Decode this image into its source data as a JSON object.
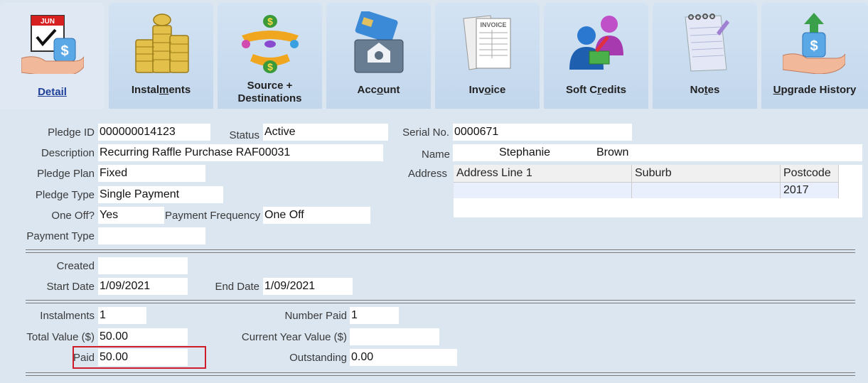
{
  "tabs": [
    {
      "id": "detail",
      "label": "Detail",
      "accel": "D",
      "rest": "etail",
      "active": true,
      "icon": "calendar-money-hand-icon"
    },
    {
      "id": "instalments",
      "label": "Instalments",
      "pre": "Instal",
      "accel": "m",
      "rest": "ents",
      "icon": "coin-stacks-icon"
    },
    {
      "id": "source",
      "label_line1": "Source +",
      "label_line2": "Destinations",
      "icon": "money-flow-icon"
    },
    {
      "id": "account",
      "label": "Account",
      "pre": "Acc",
      "accel": "o",
      "rest": "unt",
      "icon": "credit-card-safe-icon"
    },
    {
      "id": "invoice",
      "label": "Invoice",
      "pre": "Inv",
      "accel": "o",
      "rest": "ice",
      "icon": "invoice-icon"
    },
    {
      "id": "softcredits",
      "label": "Soft Credits",
      "pre": "Soft C",
      "accel": "r",
      "rest": "edits",
      "icon": "people-money-icon"
    },
    {
      "id": "notes",
      "label": "Notes",
      "pre": "No",
      "accel": "t",
      "rest": "es",
      "icon": "notepad-icon"
    },
    {
      "id": "upgrade",
      "label": "Upgrade History",
      "accel": "U",
      "rest": "pgrade History",
      "icon": "money-hand-upgrade-icon"
    }
  ],
  "pledge": {
    "id_label": "Pledge ID",
    "id": "000000014123",
    "status_label": "Status",
    "status": "Active",
    "serial_label": "Serial No.",
    "serial": "0000671",
    "description_label": "Description",
    "description": "Recurring Raffle Purchase RAF00031",
    "name_label": "Name",
    "first_name": "Stephanie",
    "last_name": "Brown",
    "plan_label": "Pledge Plan",
    "plan": "Fixed",
    "address_label": "Address",
    "type_label": "Pledge Type",
    "type": "Single Payment",
    "oneoff_label": "One Off?",
    "oneoff": "Yes",
    "frequency_label": "Payment Frequency",
    "frequency": "One Off",
    "payment_type_label": "Payment Type",
    "payment_type": ""
  },
  "address": {
    "columns": [
      "Address Line 1",
      "Suburb",
      "Postcode"
    ],
    "rows": [
      [
        "",
        "",
        "2017"
      ]
    ]
  },
  "dates": {
    "created_label": "Created",
    "created": "",
    "start_label": "Start Date",
    "start": "1/09/2021",
    "end_label": "End Date",
    "end": "1/09/2021"
  },
  "totals": {
    "instalments_label": "Instalments",
    "instalments": "1",
    "number_paid_label": "Number Paid",
    "number_paid": "1",
    "total_value_label": "Total Value ($)",
    "total_value": "50.00",
    "current_year_label": "Current Year Value ($)",
    "current_year": "",
    "paid_label": "Paid",
    "paid": "50.00",
    "outstanding_label": "Outstanding",
    "outstanding": "0.00"
  },
  "colors": {
    "highlight": "#d01c2a",
    "accent": "#1f3f9a"
  }
}
